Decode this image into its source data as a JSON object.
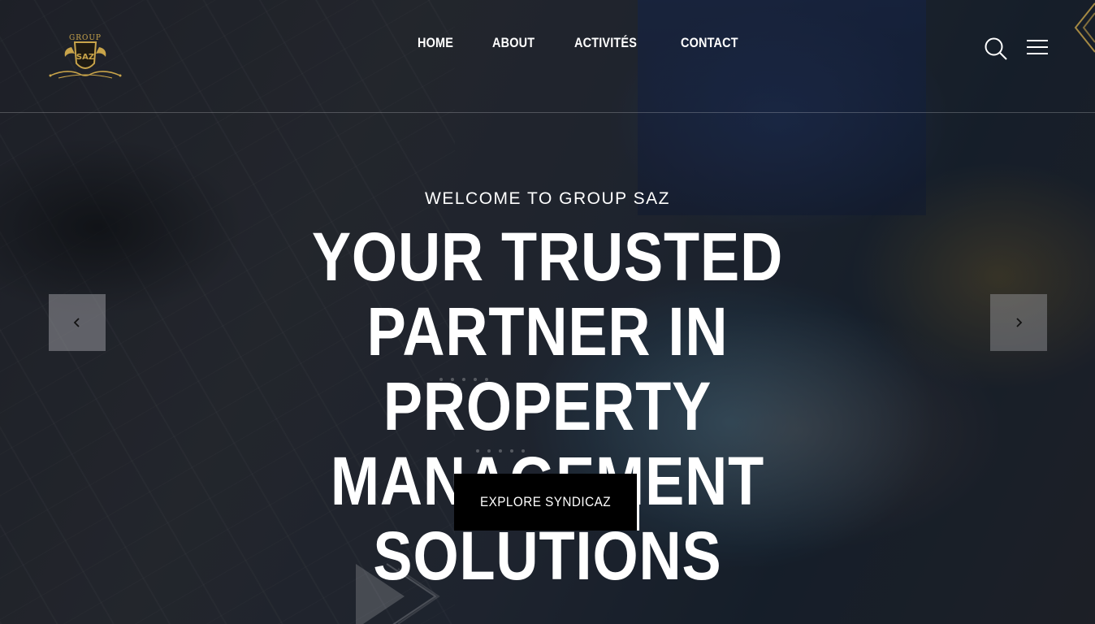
{
  "brand": {
    "logo_top_text": "GROUP",
    "logo_text": "SAZ",
    "gold": "#c9a44a"
  },
  "nav": {
    "items": [
      {
        "label": "HOME"
      },
      {
        "label": "ABOUT"
      },
      {
        "label": "ACTIVITÉS"
      },
      {
        "label": "CONTACT"
      }
    ]
  },
  "header_icons": [
    "search-icon",
    "menu-icon"
  ],
  "hero": {
    "eyebrow": "WELCOME TO GROUP SAZ",
    "headline": "YOUR TRUSTED PARTNER IN PROPERTY MANAGEMENT SOLUTIONS",
    "cta_label": "EXPLORE SYNDICAZ",
    "cta_bg": "#000000"
  },
  "slider": {
    "prev_icon": "chevron-left-icon",
    "next_icon": "chevron-right-icon"
  }
}
